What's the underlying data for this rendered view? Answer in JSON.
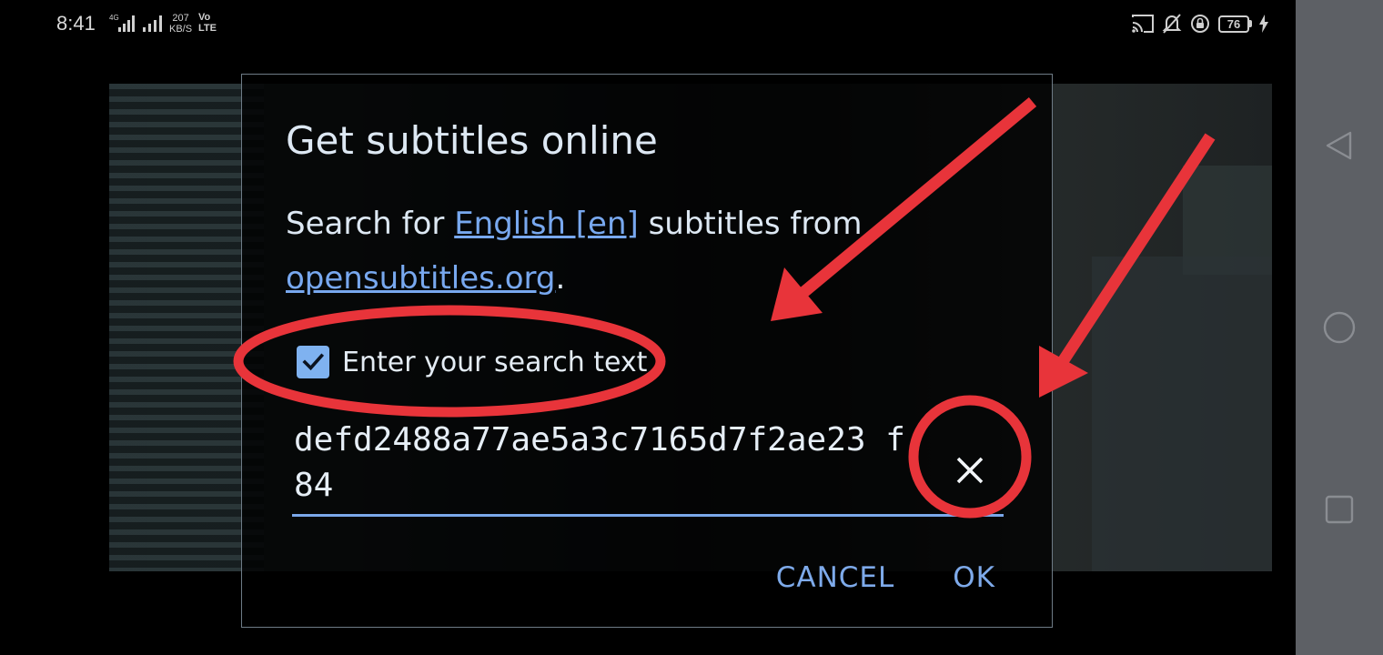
{
  "status_bar": {
    "time": "8:41",
    "net_speed_value": "207",
    "net_speed_unit": "KB/S",
    "volte_top": "Vo",
    "volte_bottom": "LTE",
    "network_type": "4G",
    "battery_level": "76"
  },
  "dialog": {
    "title": "Get subtitles online",
    "search_prefix": "Search for ",
    "language_link": "English [en]",
    "search_suffix": " subtitles from",
    "source_link": "opensubtitles.org",
    "source_suffix": ".",
    "checkbox_label": "Enter your search text",
    "checkbox_checked": true,
    "search_value": "defd2488a77ae5a3c7165d7f2ae23 f84",
    "cancel_label": "CANCEL",
    "ok_label": "OK"
  },
  "colors": {
    "accent": "#7eaaea",
    "annotation": "#e8343a",
    "dialog_text": "#dde8f3"
  },
  "icons": {
    "clear": "close-icon",
    "checkbox": "checkmark-icon",
    "cast": "cast-icon",
    "mute": "bell-off-icon",
    "rotation_lock": "rotation-lock-icon",
    "charging": "lightning-icon",
    "nav_back": "triangle-back-icon",
    "nav_home": "circle-home-icon",
    "nav_recents": "square-recents-icon"
  }
}
